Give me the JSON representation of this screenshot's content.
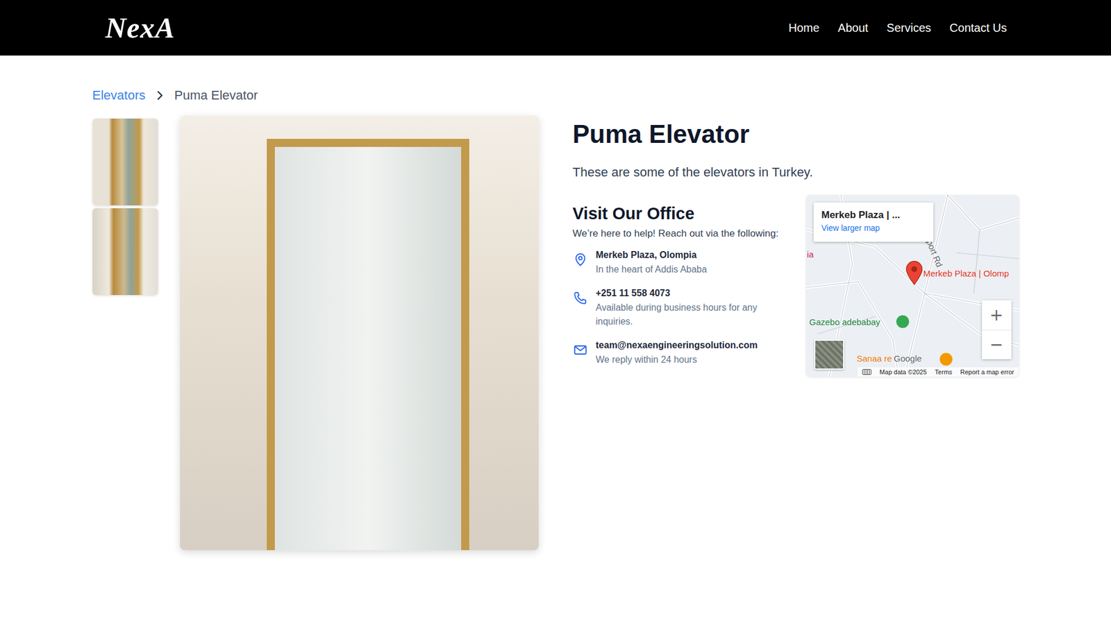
{
  "nav": {
    "logo": "NexA",
    "links": [
      {
        "label": "Home"
      },
      {
        "label": "About"
      },
      {
        "label": "Services"
      },
      {
        "label": "Contact Us"
      }
    ]
  },
  "breadcrumb": [
    {
      "label": "Elevators",
      "current": false
    },
    {
      "label": "Puma Elevator",
      "current": true
    }
  ],
  "product": {
    "title": "Puma Elevator",
    "description": "These are some of the elevators in Turkey."
  },
  "office": {
    "title": "Visit Our Office",
    "subtitle": "We’re here to help! Reach out via the following:",
    "items": [
      {
        "kind": "location",
        "title": "Merkeb Plaza, Olompia",
        "detail": "In the heart of Addis Ababa"
      },
      {
        "kind": "phone",
        "title": "+251 11 558 4073",
        "detail": "Available during business hours for any inquiries."
      },
      {
        "kind": "email",
        "title": "team@nexaengineeringsolution.com",
        "detail": "We reply within 24 hours"
      }
    ]
  },
  "map": {
    "info_title": "Merkeb Plaza | ...",
    "info_link": "View larger map",
    "labels": [
      {
        "text": "ia",
        "kind": "area",
        "color": "#c2185b"
      },
      {
        "text": "Airport Rd",
        "kind": "road",
        "color": "#5f6368"
      },
      {
        "text": "Merkeb Plaza | Olomp",
        "kind": "place",
        "color": "#d93025"
      },
      {
        "text": "Gazebo adebabay",
        "kind": "park",
        "color": "#188038"
      },
      {
        "text": "Sanaa re",
        "kind": "restaurant",
        "color": "#e8710a"
      },
      {
        "text": "Google",
        "kind": "brand",
        "color": "#5f6368"
      }
    ],
    "zoom": [
      "+",
      "−"
    ],
    "footer": [
      "Map data ©2025",
      "Terms",
      "Report a map error"
    ]
  }
}
